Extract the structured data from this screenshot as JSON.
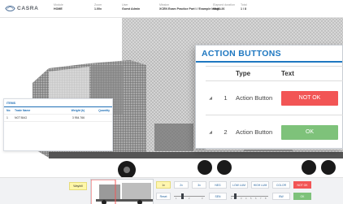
{
  "header": {
    "logo_text": "CASRA",
    "columns": [
      {
        "label": "Module",
        "value": "HOME"
      },
      {
        "label": "Zoom",
        "value": "1.00x"
      },
      {
        "label": "User",
        "value": "Guest Admin"
      },
      {
        "label": "Mission",
        "value": "XCEN Exam Practice Part I / Example Imag..."
      },
      {
        "label": "Elapsed duration",
        "value": "00:00:26"
      },
      {
        "label": "Total",
        "value": "1 / 8"
      }
    ]
  },
  "items_panel": {
    "title": "ITEMS",
    "columns": [
      "No",
      "Trade Name",
      "Weight (k)",
      "Quantity"
    ],
    "rows": [
      {
        "no": "1",
        "name": "NOT BAG",
        "weight": "3 954.766",
        "qty": ""
      }
    ]
  },
  "dialog": {
    "title": "ACTION BUTTONS",
    "columns": [
      "Type",
      "Text"
    ],
    "rows": [
      {
        "num": "1",
        "type": "Action Button",
        "text": "NOT OK",
        "color": "#f25555"
      },
      {
        "num": "2",
        "type": "Action Button",
        "text": "OK",
        "color": "#7ec27a"
      }
    ]
  },
  "toolbar": {
    "waybill": "Waybill",
    "zoom": [
      "1x",
      "2x",
      "3x"
    ],
    "reset": "Reset",
    "slider_ticks": [
      "1",
      "2",
      "3"
    ],
    "buttons": [
      "NEG",
      "LOW LUM",
      "HIGH LUM",
      "COLOR"
    ],
    "sen": "SEN",
    "bw": "BW",
    "not_ok": "NOT OK",
    "ok": "OK",
    "sen_ticks": [
      "1",
      "2",
      "3",
      "4",
      "5",
      "6",
      "7",
      "8"
    ]
  },
  "colors": {
    "accent": "#1f78c1",
    "danger": "#f25555",
    "success": "#7ec27a"
  }
}
